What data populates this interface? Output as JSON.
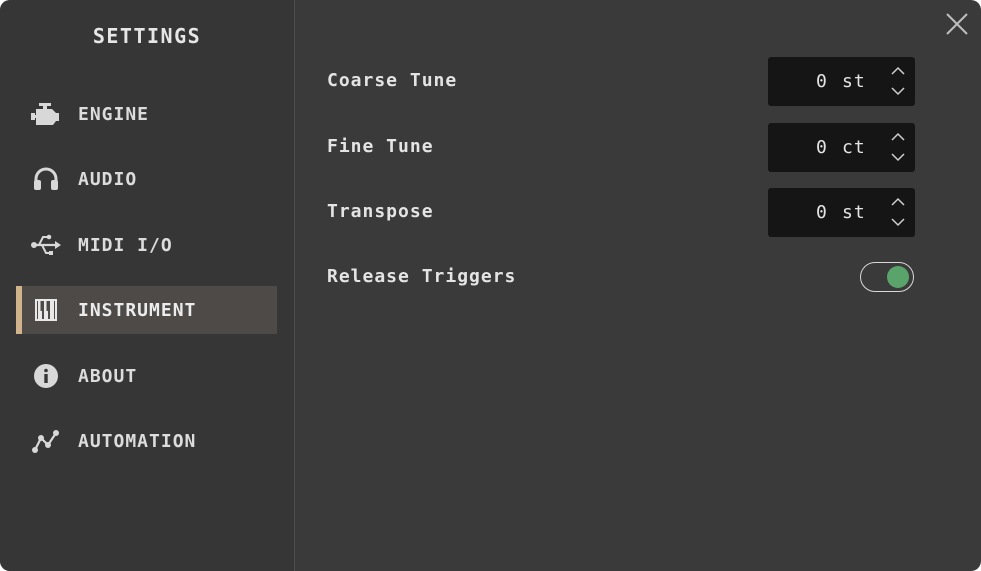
{
  "sidebar": {
    "title": "SETTINGS",
    "items": [
      {
        "label": "ENGINE",
        "icon": "engine-icon"
      },
      {
        "label": "AUDIO",
        "icon": "headphones-icon"
      },
      {
        "label": "MIDI I/O",
        "icon": "usb-icon"
      },
      {
        "label": "INSTRUMENT",
        "icon": "piano-keys-icon",
        "active": true
      },
      {
        "label": "ABOUT",
        "icon": "info-icon"
      },
      {
        "label": "AUTOMATION",
        "icon": "automation-curve-icon"
      }
    ]
  },
  "instrument": {
    "coarse_tune": {
      "label": "Coarse Tune",
      "value": "0",
      "unit": "st"
    },
    "fine_tune": {
      "label": "Fine Tune",
      "value": "0",
      "unit": "ct"
    },
    "transpose": {
      "label": "Transpose",
      "value": "0",
      "unit": "st"
    },
    "release_triggers": {
      "label": "Release Triggers",
      "enabled": true
    }
  },
  "colors": {
    "window_bg": "#3a3a3a",
    "sidebar_bg": "#363636",
    "active_item_bg": "#4d4a47",
    "accent": "#d1b48c",
    "toggle_on": "#5aa46b",
    "field_bg": "#151515"
  }
}
